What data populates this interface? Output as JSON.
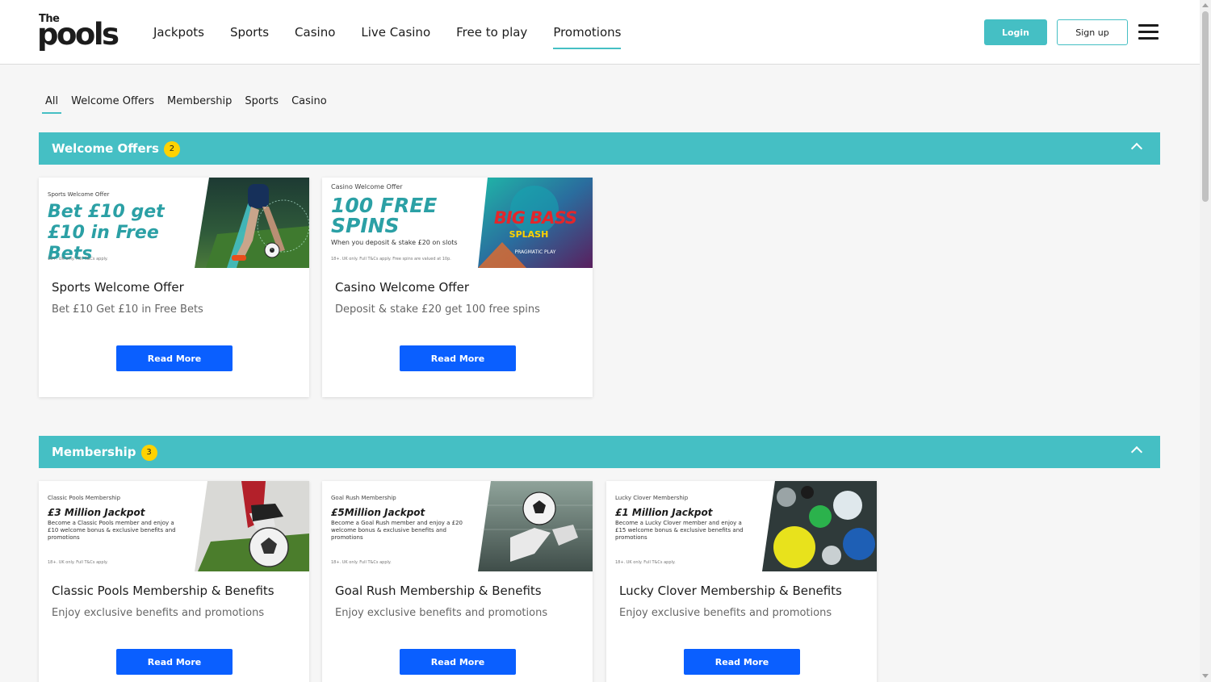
{
  "header": {
    "logo_top": "The",
    "logo_word": "pools",
    "nav": [
      "Jackpots",
      "Sports",
      "Casino",
      "Live Casino",
      "Free to play",
      "Promotions"
    ],
    "active_nav": "Promotions",
    "login_label": "Login",
    "signup_label": "Sign up"
  },
  "tabs": [
    "All",
    "Welcome Offers",
    "Membership",
    "Sports",
    "Casino"
  ],
  "active_tab": "All",
  "colors": {
    "teal": "#45bfc4",
    "blue": "#0a5fff",
    "badge": "#ffd200"
  },
  "sections": [
    {
      "title": "Welcome Offers",
      "count": "2",
      "cards": [
        {
          "banner_label": "Sports Welcome Offer",
          "banner_headline": "Bet £10 get £10 in Free Bets",
          "banner_sub": "",
          "banner_fine": "18+. UK only. Full T&Cs apply.",
          "title": "Sports Welcome Offer",
          "desc": "Bet £10 Get £10 in Free Bets",
          "button": "Read More"
        },
        {
          "banner_label": "Casino Welcome Offer",
          "banner_headline": "100 FREE SPINS",
          "banner_sub": "When you deposit & stake £20 on slots",
          "banner_fine": "18+. UK only. Full T&Cs apply. Free spins are valued at 10p.",
          "banner_art_title": "BIG BASS",
          "banner_art_sub": "SPLASH",
          "banner_art_brand": "PRAGMATIC PLAY",
          "title": "Casino Welcome Offer",
          "desc": "Deposit & stake £20 get 100 free spins",
          "button": "Read More"
        }
      ]
    },
    {
      "title": "Membership",
      "count": "3",
      "cards": [
        {
          "banner_label": "Classic Pools Membership",
          "banner_headline": "£3 Million Jackpot",
          "banner_sub": "Become a Classic Pools member and enjoy a £10 welcome bonus & exclusive benefits and promotions",
          "banner_fine": "18+. UK only. Full T&Cs apply.",
          "title": "Classic Pools Membership & Benefits",
          "desc": "Enjoy exclusive benefits and promotions",
          "button": "Read More"
        },
        {
          "banner_label": "Goal Rush Membership",
          "banner_headline": "£5Million Jackpot",
          "banner_sub": "Become a Goal Rush member and enjoy a £20 welcome bonus & exclusive benefits and promotions",
          "banner_fine": "18+. UK only. Full T&Cs apply.",
          "title": "Goal Rush Membership & Benefits",
          "desc": "Enjoy exclusive benefits and promotions",
          "button": "Read More"
        },
        {
          "banner_label": "Lucky Clover Membership",
          "banner_headline": "£1 Million Jackpot",
          "banner_sub": "Become a Lucky Clover member and enjoy a £15 welcome bonus & exclusive benefits and promotions",
          "banner_fine": "18+. UK only. Full T&Cs apply.",
          "title": "Lucky Clover Membership & Benefits",
          "desc": "Enjoy exclusive benefits and promotions",
          "button": "Read More"
        }
      ]
    }
  ]
}
